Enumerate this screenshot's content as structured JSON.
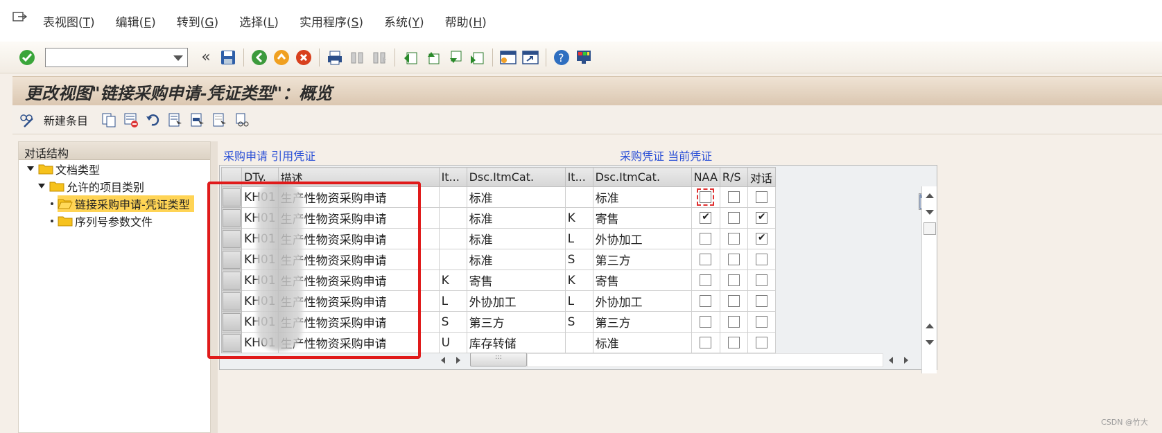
{
  "menubar": {
    "items": [
      {
        "label": "表视图(",
        "acc": "T",
        "suffix": ")"
      },
      {
        "label": "编辑(",
        "acc": "E",
        "suffix": ")"
      },
      {
        "label": "转到(",
        "acc": "G",
        "suffix": ")"
      },
      {
        "label": "选择(",
        "acc": "L",
        "suffix": ")"
      },
      {
        "label": "实用程序(",
        "acc": "S",
        "suffix": ")"
      },
      {
        "label": "系统(",
        "acc": "Y",
        "suffix": ")"
      },
      {
        "label": "帮助(",
        "acc": "H",
        "suffix": ")"
      }
    ]
  },
  "toolbar": {
    "command_field_value": "",
    "collapse_glyph": "«"
  },
  "title": "更改视图\"链接采购申请-凭证类型\"：概览",
  "apptoolbar": {
    "new_entries_label": "新建条目"
  },
  "tree": {
    "header": "对话结构",
    "items": [
      {
        "label": "文档类型"
      },
      {
        "label": "允许的项目类别"
      },
      {
        "label": "链接采购申请-凭证类型"
      },
      {
        "label": "序列号参数文件"
      }
    ]
  },
  "groups": {
    "left": "采购申请 引用凭证",
    "right": "采购凭证 当前凭证"
  },
  "table": {
    "headers": [
      "DTy.",
      "描述",
      "It...",
      "Dsc.ItmCat.",
      "It...",
      "Dsc.ItmCat.",
      "NAA",
      "R/S",
      "对话"
    ],
    "rows": [
      {
        "dty": "KH01",
        "desc": "生产性物资采购申请",
        "it1": "",
        "dsc1": "标准",
        "it2": "",
        "dsc2": "标准",
        "naa": false,
        "rs": false,
        "dlg": false
      },
      {
        "dty": "KH01",
        "desc": "生产性物资采购申请",
        "it1": "",
        "dsc1": "标准",
        "it2": "K",
        "dsc2": "寄售",
        "naa": true,
        "rs": false,
        "dlg": true
      },
      {
        "dty": "KH01",
        "desc": "生产性物资采购申请",
        "it1": "",
        "dsc1": "标准",
        "it2": "L",
        "dsc2": "外协加工",
        "naa": false,
        "rs": false,
        "dlg": true
      },
      {
        "dty": "KH01",
        "desc": "生产性物资采购申请",
        "it1": "",
        "dsc1": "标准",
        "it2": "S",
        "dsc2": "第三方",
        "naa": false,
        "rs": false,
        "dlg": false
      },
      {
        "dty": "KH01",
        "desc": "生产性物资采购申请",
        "it1": "K",
        "dsc1": "寄售",
        "it2": "K",
        "dsc2": "寄售",
        "naa": false,
        "rs": false,
        "dlg": false
      },
      {
        "dty": "KH01",
        "desc": "生产性物资采购申请",
        "it1": "L",
        "dsc1": "外协加工",
        "it2": "L",
        "dsc2": "外协加工",
        "naa": false,
        "rs": false,
        "dlg": false
      },
      {
        "dty": "KH01",
        "desc": "生产性物资采购申请",
        "it1": "S",
        "dsc1": "第三方",
        "it2": "S",
        "dsc2": "第三方",
        "naa": false,
        "rs": false,
        "dlg": false
      },
      {
        "dty": "KH01",
        "desc": "生产性物资采购申请",
        "it1": "U",
        "dsc1": "库存转储",
        "it2": "",
        "dsc2": "标准",
        "naa": false,
        "rs": false,
        "dlg": false
      }
    ]
  },
  "hscroll_thumb_glyph": ":::",
  "watermark": "CSDN @竹大",
  "colors": {
    "group_label": "#2a4fd6",
    "highlight_box": "#e01a1a",
    "tree_selected": "#ffd455"
  }
}
